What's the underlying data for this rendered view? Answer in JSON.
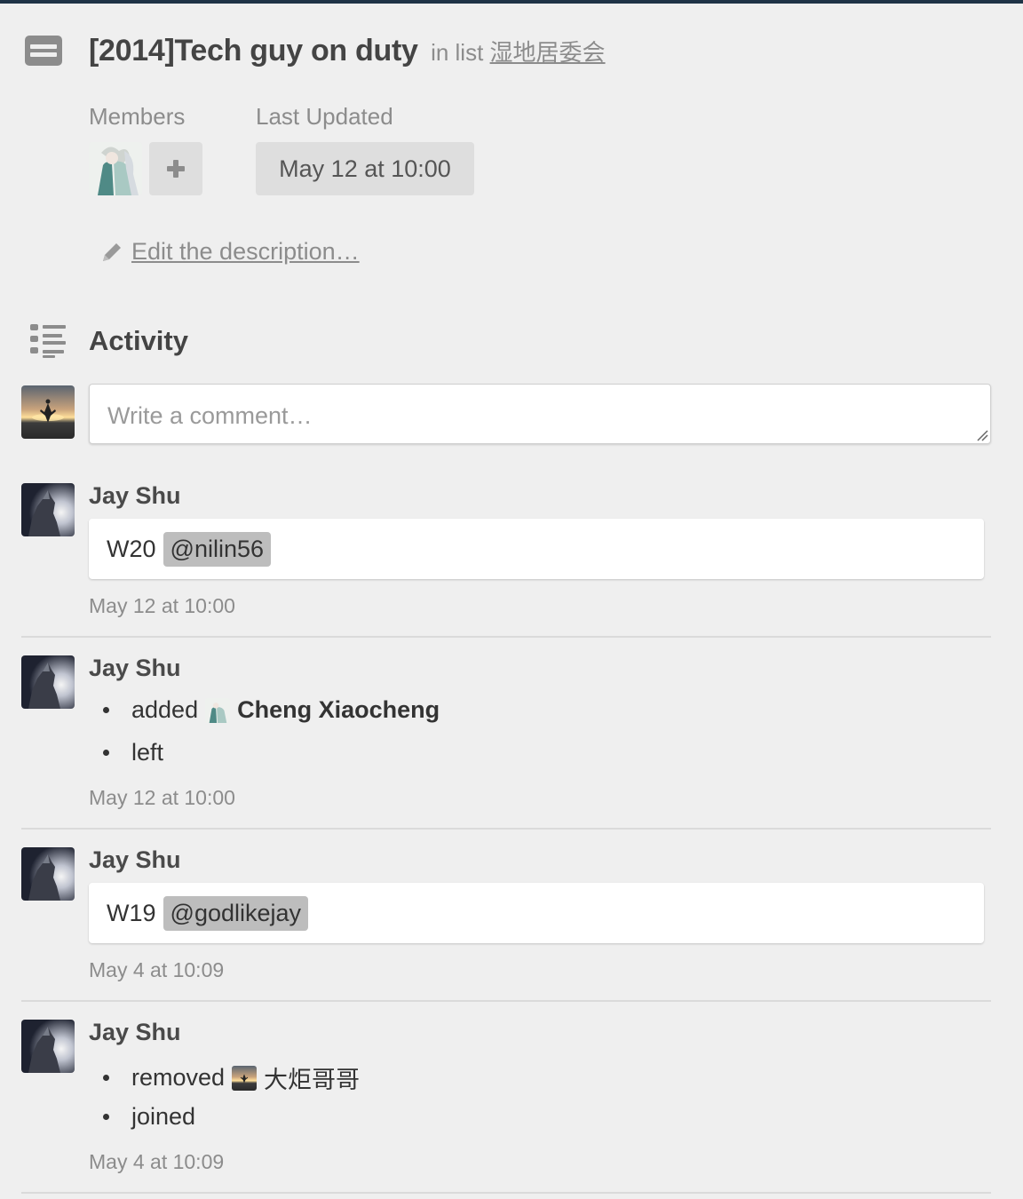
{
  "card": {
    "title": "[2014]Tech guy on duty",
    "in_list_prefix": "in list",
    "list_name": "湿地居委会"
  },
  "members": {
    "label": "Members",
    "add_icon": "plus-icon"
  },
  "last_updated": {
    "label": "Last Updated",
    "value": "May 12 at 10:00"
  },
  "description": {
    "edit_label": "Edit the description…",
    "icon": "pencil-icon"
  },
  "activity": {
    "title": "Activity",
    "icon": "activity-list-icon",
    "comment_placeholder": "Write a comment…",
    "items": [
      {
        "author": "Jay Shu",
        "comment": "W20",
        "mention": "@nilin56",
        "timestamp": "May 12 at 10:00"
      },
      {
        "author": "Jay Shu",
        "bullets": [
          {
            "verb": "added",
            "name": "Cheng Xiaocheng"
          },
          {
            "verb": "left"
          }
        ],
        "timestamp": "May 12 at 10:00"
      },
      {
        "author": "Jay Shu",
        "comment": "W19",
        "mention": "@godlikejay",
        "timestamp": "May 4 at 10:09"
      },
      {
        "author": "Jay Shu",
        "bullets": [
          {
            "verb": "removed",
            "name": "大炬哥哥"
          },
          {
            "verb": "joined"
          }
        ],
        "timestamp": "May 4 at 10:09"
      }
    ]
  },
  "colors": {
    "background": "#efefef",
    "topbar": "#1f3346",
    "mention_bg": "#bdbdbd"
  }
}
